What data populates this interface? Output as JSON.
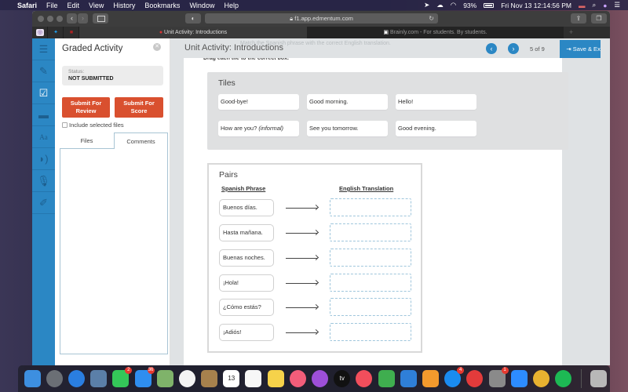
{
  "menubar": {
    "apple_icon": "apple-logo-icon",
    "app_name": "Safari",
    "items": [
      "File",
      "Edit",
      "View",
      "History",
      "Bookmarks",
      "Window",
      "Help"
    ],
    "battery": "93%",
    "datetime": "Fri Nov 13  12:14:56 PM"
  },
  "browser": {
    "url": "f1.app.edmentum.com",
    "tabs": [
      {
        "label": "Unit Activity: Introductions",
        "active": true
      },
      {
        "label": "Brainly.com - For students. By students.",
        "active": false
      }
    ],
    "new_tab": "+"
  },
  "left_nav": {
    "items": [
      {
        "name": "table-of-contents",
        "icon": "list-icon"
      },
      {
        "name": "notes",
        "icon": "edit-note-icon"
      },
      {
        "name": "graded-activity",
        "icon": "checklist-icon",
        "active": true
      },
      {
        "name": "files",
        "icon": "folder-icon"
      },
      {
        "name": "dictionary",
        "icon": "dictionary-icon"
      },
      {
        "name": "text-to-speech",
        "icon": "speaker-head-icon"
      },
      {
        "name": "record",
        "icon": "microphone-icon"
      },
      {
        "name": "highlighter",
        "icon": "highlighter-icon"
      }
    ]
  },
  "panel": {
    "title": "Graded Activity",
    "status_label": "Status:",
    "status_value": "NOT SUBMITTED",
    "submit_review": "Submit For Review",
    "submit_score": "Submit For Score",
    "include_files": "Include selected files",
    "include_checked": false,
    "tabs": [
      "Files",
      "Comments"
    ],
    "active_tab": "Comments"
  },
  "header": {
    "title": "Unit Activity: Introductions",
    "instruction_ghost": "Match the Spanish phrase with the correct English translation.",
    "instruction2_ghost": "Drag each tile to the correct box.",
    "page_current": 5,
    "page_total": 9,
    "page_label": "5  of  9",
    "save_exit": "Save & Exit"
  },
  "tiles": {
    "title": "Tiles",
    "items": [
      {
        "text": "Good-bye!"
      },
      {
        "text": "Good morning."
      },
      {
        "text": "Hello!"
      },
      {
        "text": "How are you?",
        "italic": "(informal)"
      },
      {
        "text": "See you tomorrow."
      },
      {
        "text": "Good evening."
      }
    ]
  },
  "pairs": {
    "title": "Pairs",
    "col_spanish": "Spanish Phrase",
    "col_english": "English Translation",
    "rows": [
      {
        "spanish": "Buenos días.",
        "english": ""
      },
      {
        "spanish": "Hasta mañana.",
        "english": ""
      },
      {
        "spanish": "Buenas noches.",
        "english": ""
      },
      {
        "spanish": "¡Hola!",
        "english": ""
      },
      {
        "spanish": "¿Cómo estás?",
        "english": ""
      },
      {
        "spanish": "¡Adiós!",
        "english": ""
      }
    ]
  },
  "dock": {
    "apps": [
      {
        "name": "finder",
        "color": "#3d8fe0"
      },
      {
        "name": "launchpad",
        "color": "#6b6f75"
      },
      {
        "name": "safari",
        "color": "#2a7ee0"
      },
      {
        "name": "preview",
        "color": "#5b7fa8"
      },
      {
        "name": "facetime",
        "color": "#34c759",
        "badge": "2"
      },
      {
        "name": "messages",
        "color": "#2f8ef0",
        "badge": "36"
      },
      {
        "name": "maps",
        "color": "#7fb36a"
      },
      {
        "name": "photos",
        "color": "#f4f4f4"
      },
      {
        "name": "contacts",
        "color": "#a7814d"
      },
      {
        "name": "calendar",
        "color": "#ffffff",
        "label": "13"
      },
      {
        "name": "reminders",
        "color": "#f7f7f7"
      },
      {
        "name": "notes",
        "color": "#f6d24a"
      },
      {
        "name": "music",
        "color": "#f25d7a"
      },
      {
        "name": "podcasts",
        "color": "#9d4fd9"
      },
      {
        "name": "apple-tv",
        "color": "#111111",
        "label": "tv"
      },
      {
        "name": "news",
        "color": "#f14e5c"
      },
      {
        "name": "numbers",
        "color": "#3fae4f"
      },
      {
        "name": "keynote",
        "color": "#2f7fd8"
      },
      {
        "name": "pages",
        "color": "#f39a2d"
      },
      {
        "name": "app-store",
        "color": "#1a8cf0",
        "badge": "4"
      },
      {
        "name": "youtube",
        "color": "#e33b3b"
      },
      {
        "name": "system-preferences",
        "color": "#8a8a8a",
        "badge": "1"
      },
      {
        "name": "zoom",
        "color": "#2d8cff"
      },
      {
        "name": "chrome",
        "color": "#e8b230"
      },
      {
        "name": "spotify",
        "color": "#1db954"
      }
    ],
    "trash": "trash-icon"
  }
}
